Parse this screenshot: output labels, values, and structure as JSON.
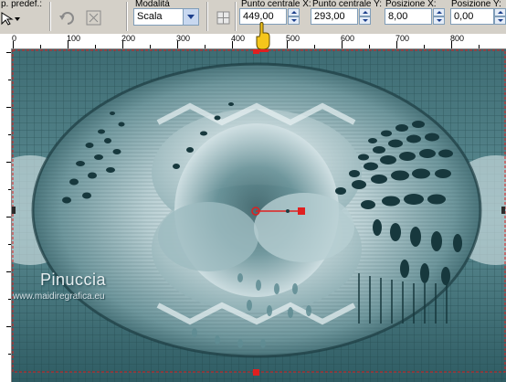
{
  "toolbar": {
    "preset_label": "p. predef.:",
    "mode_label": "Modalità",
    "mode_value": "Scala",
    "center_x_label": "Punto centrale X:",
    "center_x_value": "449,00",
    "center_y_label": "Punto centrale Y:",
    "center_y_value": "293,00",
    "pos_x_label": "Posizione X:",
    "pos_x_value": "8,00",
    "pos_y_label": "Posizione Y:",
    "pos_y_value": "0,00"
  },
  "ruler": {
    "h_labels": [
      "0",
      "100",
      "200",
      "300",
      "400",
      "500",
      "600",
      "700",
      "800"
    ],
    "v_labels": [
      "0",
      "100",
      "200",
      "300",
      "400",
      "500",
      "600",
      "700"
    ]
  },
  "watermark": {
    "name": "Pinuccia",
    "site": "www.maidiregrafica.eu"
  },
  "colors": {
    "teal_dark": "#1f4a52",
    "teal_mid": "#6f9aa1",
    "teal_light": "#d9e7ea",
    "handle_red": "#e02020"
  },
  "icons": [
    "preset-icon",
    "undo-icon",
    "reset-icon",
    "hand-pointer-icon"
  ]
}
